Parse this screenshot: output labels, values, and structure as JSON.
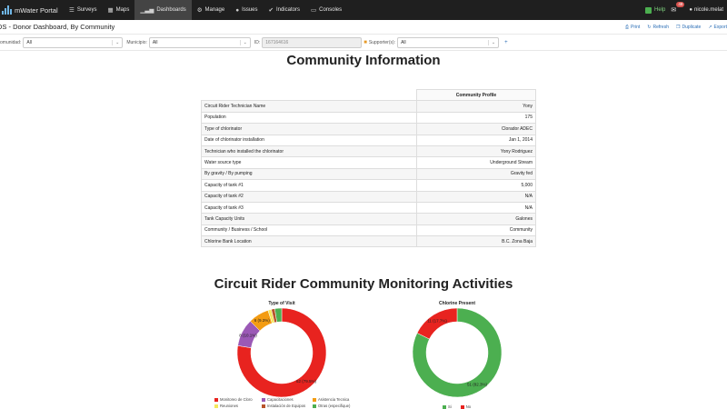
{
  "nav": {
    "brand": "mWater Portal",
    "items": [
      {
        "label": "Surveys",
        "icon": "list-icon",
        "glyph": "☰",
        "active": false
      },
      {
        "label": "Maps",
        "icon": "map-icon",
        "glyph": "▦",
        "active": false
      },
      {
        "label": "Dashboards",
        "icon": "chart-icon",
        "glyph": "▁▃▅",
        "active": true
      },
      {
        "label": "Manage",
        "icon": "gear-icon",
        "glyph": "⚙",
        "active": false
      },
      {
        "label": "Issues",
        "icon": "alert-icon",
        "glyph": "●",
        "active": false
      },
      {
        "label": "Indicators",
        "icon": "check-circle-icon",
        "glyph": "✔",
        "active": false
      },
      {
        "label": "Consoles",
        "icon": "monitor-icon",
        "glyph": "▭",
        "active": false
      }
    ],
    "help": "Help",
    "notifications": "48",
    "user": "nicole.melat"
  },
  "header": {
    "title": "DS - Donor Dashboard, By Community",
    "actions": [
      "Print",
      "Refresh",
      "Duplicate",
      "Export"
    ]
  },
  "filters": {
    "comunidad_label": "omunidad:",
    "comunidad_value": "All",
    "municipio_label": "Municipio:",
    "municipio_value": "All",
    "id_label": "ID:",
    "id_value": "167164616",
    "supporter_label": "Supporter(s):",
    "supporter_value": "All",
    "extra_link": "+"
  },
  "community_info": {
    "title": "Community Information",
    "column_header": "Community Profile",
    "rows": [
      {
        "label": "Circuit Rider Technician Name",
        "value": "Yony"
      },
      {
        "label": "Population",
        "value": "175"
      },
      {
        "label": "Type of chlorinator",
        "value": "Clorador ADEC"
      },
      {
        "label": "Date of chlorinator installation",
        "value": "Jan 1, 2014"
      },
      {
        "label": "Technician who installed the chlorinator",
        "value": "Yony Rodriguez"
      },
      {
        "label": "Water source type",
        "value": "Underground Stream"
      },
      {
        "label": "By gravity / By pumping",
        "value": "Gravity fed"
      },
      {
        "label": "Capacity of tank #1",
        "value": "5,000"
      },
      {
        "label": "Capacity of tank #2",
        "value": "N/A"
      },
      {
        "label": "Capacity of tank #3",
        "value": "N/A"
      },
      {
        "label": "Tank Capacity Units",
        "value": "Galones"
      },
      {
        "label": "Community / Business / School",
        "value": "Community"
      },
      {
        "label": "Chlorine Bank Location",
        "value": "B.C. Zona Baja"
      }
    ]
  },
  "monitoring": {
    "title": "Circuit Rider Community Monitoring Activities"
  },
  "chart_data": [
    {
      "type": "pie",
      "title": "Type of Visit",
      "categories": [
        "Monitoreo de Cloro",
        "Capacitaciones",
        "Asistencia Tecnica",
        "Reuniones",
        "Instalación de Equipos",
        "Otras (especifique)"
      ],
      "values": [
        62,
        8,
        6,
        1,
        1,
        2
      ],
      "labels": [
        "62 (79.5%)",
        "8 (10.1%)",
        "6 (9.3%)",
        "",
        "",
        ""
      ],
      "colors": [
        "#e8231f",
        "#9b59b6",
        "#f39c12",
        "#f4e85c",
        "#b8532a",
        "#4caf50"
      ],
      "legend": "bottom"
    },
    {
      "type": "pie",
      "title": "Chlorine Present",
      "categories": [
        "Si",
        "No"
      ],
      "values": [
        51,
        11
      ],
      "labels": [
        "51 (82.3%)",
        "11 (17.7%)"
      ],
      "colors": [
        "#4caf50",
        "#e8231f"
      ],
      "legend": "bottom"
    }
  ]
}
